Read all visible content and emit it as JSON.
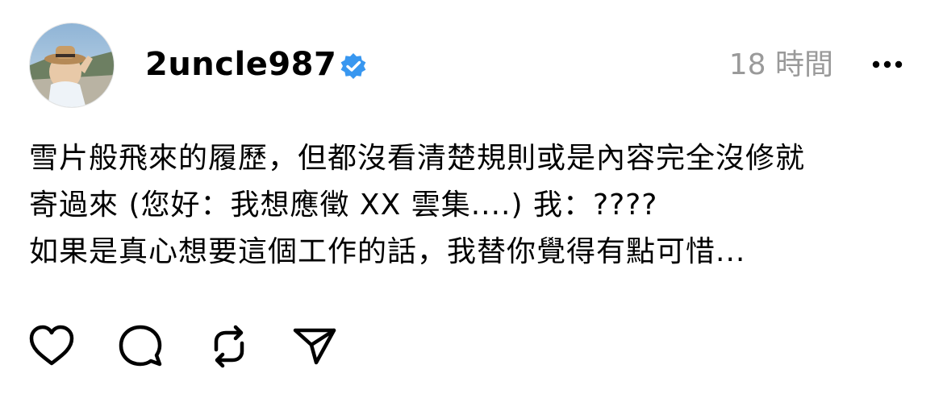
{
  "author": {
    "username": "2uncle987",
    "verified": true,
    "avatar_icon": "profile-photo-person-with-hat"
  },
  "post": {
    "timestamp": "18 時間",
    "lines": [
      "雪片般飛來的履歷，但都沒看清楚規則或是內容完全沒修就",
      "寄過來 (您好：我想應徵 XX 雲集....) 我：????",
      "如果是真心想要這個工作的話，我替你覺得有點可惜..."
    ]
  },
  "actions": [
    {
      "icon": "heart-icon"
    },
    {
      "icon": "comment-icon"
    },
    {
      "icon": "repost-icon"
    },
    {
      "icon": "share-icon"
    }
  ],
  "colors": {
    "verified_badge": "#3897f0",
    "timestamp": "#9a9a9a",
    "text": "#000000"
  }
}
